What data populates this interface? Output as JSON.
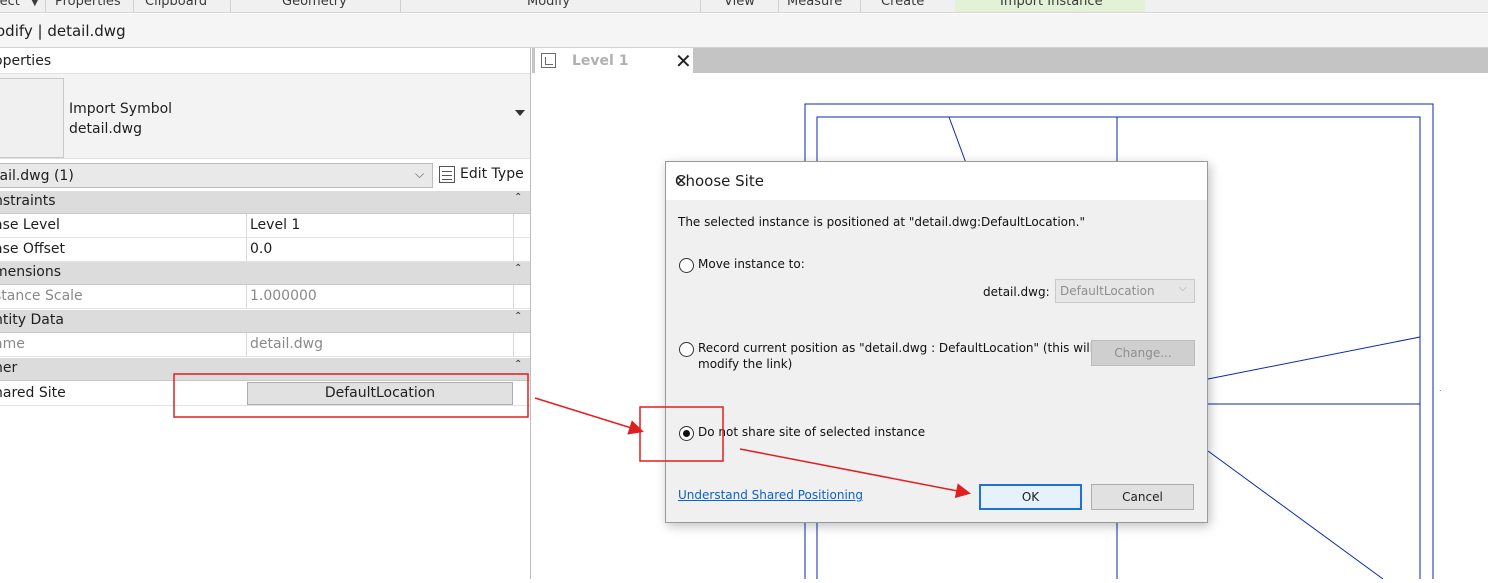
{
  "ribbon": {
    "groups": [
      "lect",
      "Properties",
      "Clipboard",
      "Geometry",
      "Modify",
      "View",
      "Measure",
      "Create",
      "Import Instance"
    ]
  },
  "context_bar": {
    "label": "odify | detail.dwg"
  },
  "properties": {
    "title": "operties",
    "type_name_line1": "Import Symbol",
    "type_name_line2": "detail.dwg",
    "instance_filter": "tail.dwg (1)",
    "edit_type_label": "Edit Type",
    "sections": {
      "constraints": "nstraints",
      "dimensions": "mensions",
      "identity": "ntity Data",
      "other": "her"
    },
    "rows": {
      "base_level": {
        "key": "ase Level",
        "value": "Level 1"
      },
      "base_offset": {
        "key": "ase Offset",
        "value": "0.0"
      },
      "instance_scale": {
        "key": "stance Scale",
        "value": "1.000000"
      },
      "name": {
        "key": "ame",
        "value": "detail.dwg"
      },
      "shared_site": {
        "key": "hared Site",
        "value": "DefaultLocation"
      }
    }
  },
  "view": {
    "tab_label": "Level 1",
    "close_glyph": "✕"
  },
  "dialog": {
    "title": "Choose Site",
    "close_glyph": "✕",
    "info": "The selected instance is positioned at \"detail.dwg:DefaultLocation.\"",
    "option_move": "Move instance to:",
    "move_target_label": "detail.dwg:",
    "move_target_value": "DefaultLocation",
    "option_record_line1": "Record current position as \"detail.dwg : DefaultLocation\" (this will",
    "option_record_line2": "modify the link)",
    "change_button": "Change...",
    "option_no_share": "Do not share site of selected instance",
    "selected_option": "no_share",
    "help_link": "Understand Shared Positioning",
    "ok_button": "OK",
    "cancel_button": "Cancel"
  },
  "colors": {
    "annotation_red": "#e02020",
    "link_blue": "#0b63c8",
    "drawing_lines": "#0a2aa8",
    "focus_blue": "#1e73d1"
  }
}
